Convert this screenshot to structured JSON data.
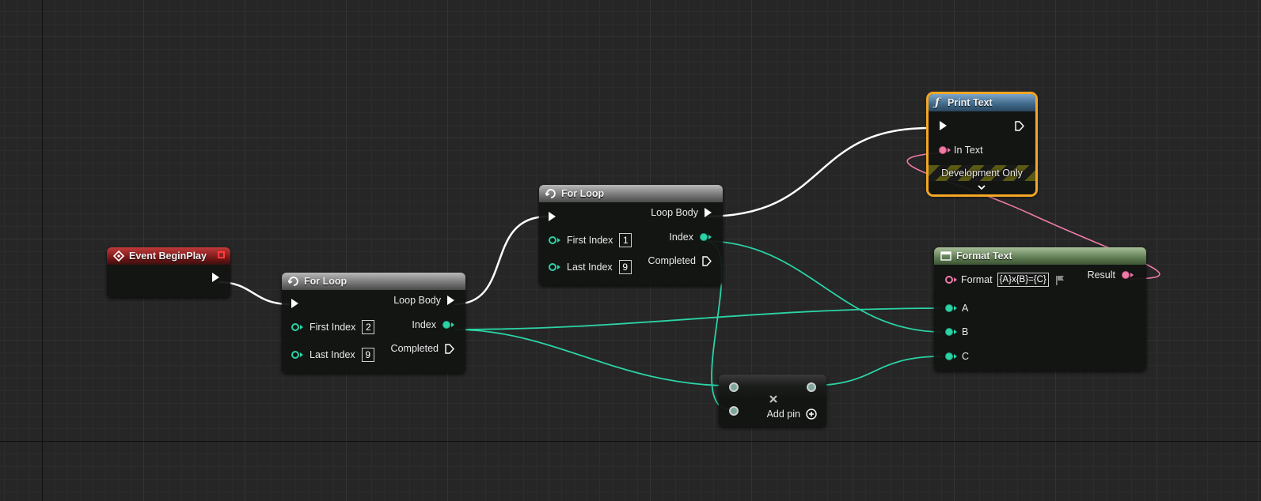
{
  "nodes": {
    "event_begin_play": {
      "title": "Event BeginPlay"
    },
    "for_loop_1": {
      "title": "For Loop",
      "first_index_label": "First Index",
      "first_index_value": "2",
      "last_index_label": "Last Index",
      "last_index_value": "9",
      "loop_body_label": "Loop Body",
      "index_label": "Index",
      "completed_label": "Completed"
    },
    "for_loop_2": {
      "title": "For Loop",
      "first_index_label": "First Index",
      "first_index_value": "1",
      "last_index_label": "Last Index",
      "last_index_value": "9",
      "loop_body_label": "Loop Body",
      "index_label": "Index",
      "completed_label": "Completed"
    },
    "print_text": {
      "title": "Print Text",
      "in_text_label": "In Text",
      "dev_only_label": "Development Only"
    },
    "format_text": {
      "title": "Format Text",
      "format_label": "Format",
      "format_value": "{A}x{B}={C}",
      "result_label": "Result",
      "pin_a": "A",
      "pin_b": "B",
      "pin_c": "C"
    },
    "multiply": {
      "add_pin_label": "Add pin"
    }
  },
  "colors": {
    "exec_wire": "#ffffff",
    "integer_wire": "#2bd3a6",
    "text_wire": "#f07aa8",
    "selection": "#f5a623",
    "grid_background": "#262626"
  },
  "icons": {
    "event": "event-diamond-icon",
    "loop": "loop-macro-icon",
    "function": "function-f-icon",
    "format": "format-text-icon",
    "multiply": "multiply-x-icon",
    "add": "add-circle-icon",
    "expand": "chevron-down-icon"
  }
}
